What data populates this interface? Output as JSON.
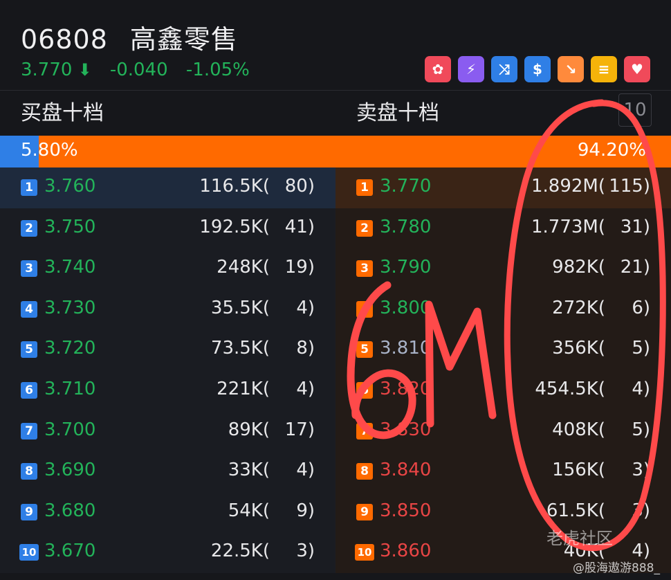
{
  "stock": {
    "code": "06808",
    "name": "高鑫零售"
  },
  "quote": {
    "price": "3.770",
    "change": "-0.040",
    "change_pct": "-1.05%"
  },
  "badges": [
    {
      "icon": "hk-flower-icon",
      "color": "#f04a5a",
      "glyph": "✿"
    },
    {
      "icon": "lightning-2-icon",
      "color": "#8a5cf0",
      "glyph": "⚡"
    },
    {
      "icon": "shuffle-icon",
      "color": "#2f7fe6",
      "glyph": "⤨"
    },
    {
      "icon": "dollar-icon",
      "color": "#2f7fe6",
      "glyph": "$"
    },
    {
      "icon": "trend-down-icon",
      "color": "#ff8a3c",
      "glyph": "↘"
    },
    {
      "icon": "note-icon",
      "color": "#f5b30a",
      "glyph": "≡"
    },
    {
      "icon": "heart-icon",
      "color": "#f04a5a",
      "glyph": "♥"
    }
  ],
  "sections": {
    "bid_title": "买盘十档",
    "ask_title": "卖盘十档",
    "depth_button": "10"
  },
  "ratio": {
    "bid_pct_label": "5.80%",
    "ask_pct_label": "94.20%",
    "bid_fraction": 0.058
  },
  "bids": [
    {
      "level": "1",
      "price": "3.760",
      "volume": "116.5K(",
      "orders": "80)"
    },
    {
      "level": "2",
      "price": "3.750",
      "volume": "192.5K(",
      "orders": "41)"
    },
    {
      "level": "3",
      "price": "3.740",
      "volume": "248K(",
      "orders": "19)"
    },
    {
      "level": "4",
      "price": "3.730",
      "volume": "35.5K(",
      "orders": "4)"
    },
    {
      "level": "5",
      "price": "3.720",
      "volume": "73.5K(",
      "orders": "8)"
    },
    {
      "level": "6",
      "price": "3.710",
      "volume": "221K(",
      "orders": "4)"
    },
    {
      "level": "7",
      "price": "3.700",
      "volume": "89K(",
      "orders": "17)"
    },
    {
      "level": "8",
      "price": "3.690",
      "volume": "33K(",
      "orders": "4)"
    },
    {
      "level": "9",
      "price": "3.680",
      "volume": "54K(",
      "orders": "9)"
    },
    {
      "level": "10",
      "price": "3.670",
      "volume": "22.5K(",
      "orders": "3)"
    }
  ],
  "asks": [
    {
      "level": "1",
      "price": "3.770",
      "volume": "1.892M(",
      "orders": "115)",
      "tone": "up"
    },
    {
      "level": "2",
      "price": "3.780",
      "volume": "1.773M(",
      "orders": "31)",
      "tone": "up"
    },
    {
      "level": "3",
      "price": "3.790",
      "volume": "982K(",
      "orders": "21)",
      "tone": "up"
    },
    {
      "level": "4",
      "price": "3.800",
      "volume": "272K(",
      "orders": "6)",
      "tone": "up"
    },
    {
      "level": "5",
      "price": "3.810",
      "volume": "356K(",
      "orders": "5)",
      "tone": "grey"
    },
    {
      "level": "6",
      "price": "3.820",
      "volume": "454.5K(",
      "orders": "4)",
      "tone": "down"
    },
    {
      "level": "7",
      "price": "3.830",
      "volume": "408K(",
      "orders": "5)",
      "tone": "down"
    },
    {
      "level": "8",
      "price": "3.840",
      "volume": "156K(",
      "orders": "3)",
      "tone": "down"
    },
    {
      "level": "9",
      "price": "3.850",
      "volume": "61.5K(",
      "orders": "3)",
      "tone": "down"
    },
    {
      "level": "10",
      "price": "3.860",
      "volume": "40K(",
      "orders": "4)",
      "tone": "down"
    }
  ],
  "annotation": {
    "text": "6M",
    "color": "#ff4a4a"
  },
  "watermark": {
    "community": "老虎社区",
    "user": "@股海遨游888_"
  },
  "colors": {
    "up": "#23b35a",
    "down": "#e84545",
    "bid_accent": "#2f7fe6",
    "ask_accent": "#ff6a00"
  }
}
